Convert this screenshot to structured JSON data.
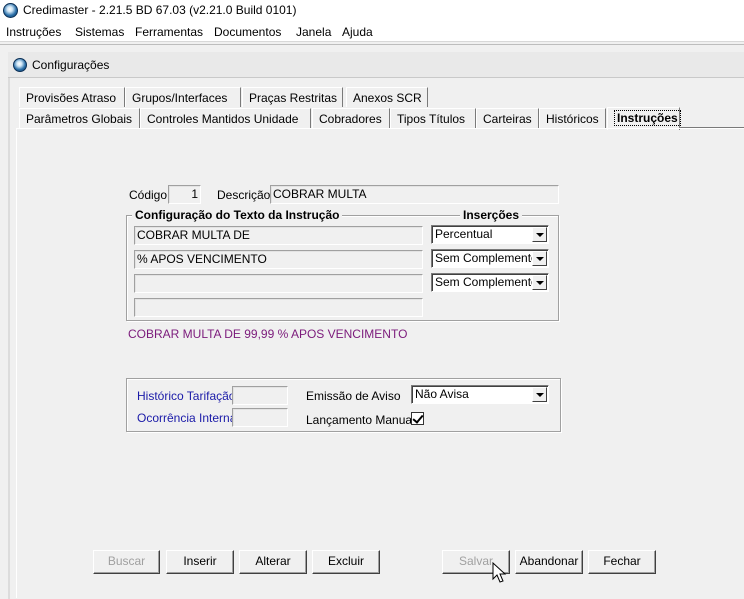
{
  "window": {
    "title": "Credimaster - 2.21.5 BD 67.03 (v2.21.0 Build 0101)"
  },
  "menu": [
    "Instruções",
    "Sistemas",
    "Ferramentas",
    "Documentos",
    "Janela",
    "Ajuda"
  ],
  "child_window": {
    "title": "Configurações"
  },
  "tabs_row1": [
    "Provisões Atraso",
    "Grupos/Interfaces",
    "Praças Restritas",
    "Anexos SCR"
  ],
  "tabs_row2": [
    "Parâmetros Globais",
    "Controles Mantidos Unidade",
    "Cobradores",
    "Tipos Títulos",
    "Carteiras",
    "Históricos",
    "Instruções"
  ],
  "active_tab": "Instruções",
  "form": {
    "codigo_label": "Código",
    "codigo_value": "1",
    "descricao_label": "Descrição",
    "descricao_value": "COBRAR MULTA",
    "config_group_title": "Configuração do Texto da Instrução",
    "insercoes_title": "Inserções",
    "text_lines": [
      "COBRAR MULTA DE",
      "% APOS VENCIMENTO",
      "",
      ""
    ],
    "insercoes": [
      "Percentual",
      "Sem Complemento",
      "Sem Complemento"
    ],
    "preview_text": "COBRAR MULTA DE 99,99 % APOS VENCIMENTO",
    "historico_tarifacao_label": "Histórico Tarifação",
    "historico_tarifacao_value": "",
    "ocorrencia_interna_label": "Ocorrência Interna",
    "ocorrencia_interna_value": "",
    "emissao_aviso_label": "Emissão de Aviso",
    "emissao_aviso_value": "Não Avisa",
    "lancamento_manual_label": "Lançamento Manual",
    "lancamento_manual_checked": true
  },
  "buttons": {
    "buscar": "Buscar",
    "inserir": "Inserir",
    "alterar": "Alterar",
    "excluir": "Excluir",
    "salvar": "Salvar",
    "abandonar": "Abandonar",
    "fechar": "Fechar"
  },
  "icons": {
    "app": "app-globe-icon",
    "child": "child-globe-icon",
    "cursor": "mouse-cursor-icon"
  }
}
